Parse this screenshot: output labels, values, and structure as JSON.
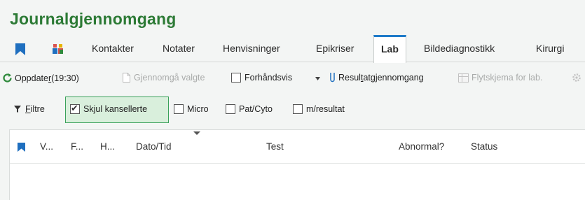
{
  "title": "Journalgjennomgang",
  "tabs": {
    "kontakter": "Kontakter",
    "notater": "Notater",
    "henvisninger": "Henvisninger",
    "epikriser": "Epikriser",
    "lab": "Lab",
    "bildediagnostikk": "Bildediagnostikk",
    "kirurgi": "Kirurgi"
  },
  "toolbar": {
    "refresh_prefix": "Oppdate",
    "refresh_underline": "r",
    "refresh_suffix": " (19:30)",
    "review_selected": "Gjennomgå valgte",
    "preview": "Forhåndsvis",
    "result_review_prefix": "Resul",
    "result_review_underline": "t",
    "result_review_suffix": "atgjennomgang",
    "flowsheet": "Flytskjema for lab."
  },
  "filters": {
    "filter_prefix": "",
    "filter_underline": "F",
    "filter_suffix": "iltre",
    "hide_cancelled": "Skjul kansellerte",
    "hide_cancelled_checked": true,
    "micro": "Micro",
    "micro_checked": false,
    "pat_cyto": "Pat/Cyto",
    "pat_cyto_checked": false,
    "with_result": "m/resultat",
    "with_result_checked": false
  },
  "grid": {
    "columns": [
      "V...",
      "F...",
      "H...",
      "Dato/Tid",
      "Test",
      "Abnormal?",
      "Status"
    ]
  },
  "colors": {
    "title_green": "#2c7a35",
    "tab_accent": "#1f7bc9",
    "bookmark_blue": "#1f6fbf",
    "refresh_green": "#2f8a3c",
    "highlight_border": "#3aa15a",
    "highlight_fill": "#d9efdc"
  },
  "icons": [
    "bookmark-icon",
    "people-icon",
    "refresh-icon",
    "document-icon",
    "dropdown-caret-icon",
    "test-tube-icon",
    "flowsheet-icon",
    "filter-icon"
  ]
}
